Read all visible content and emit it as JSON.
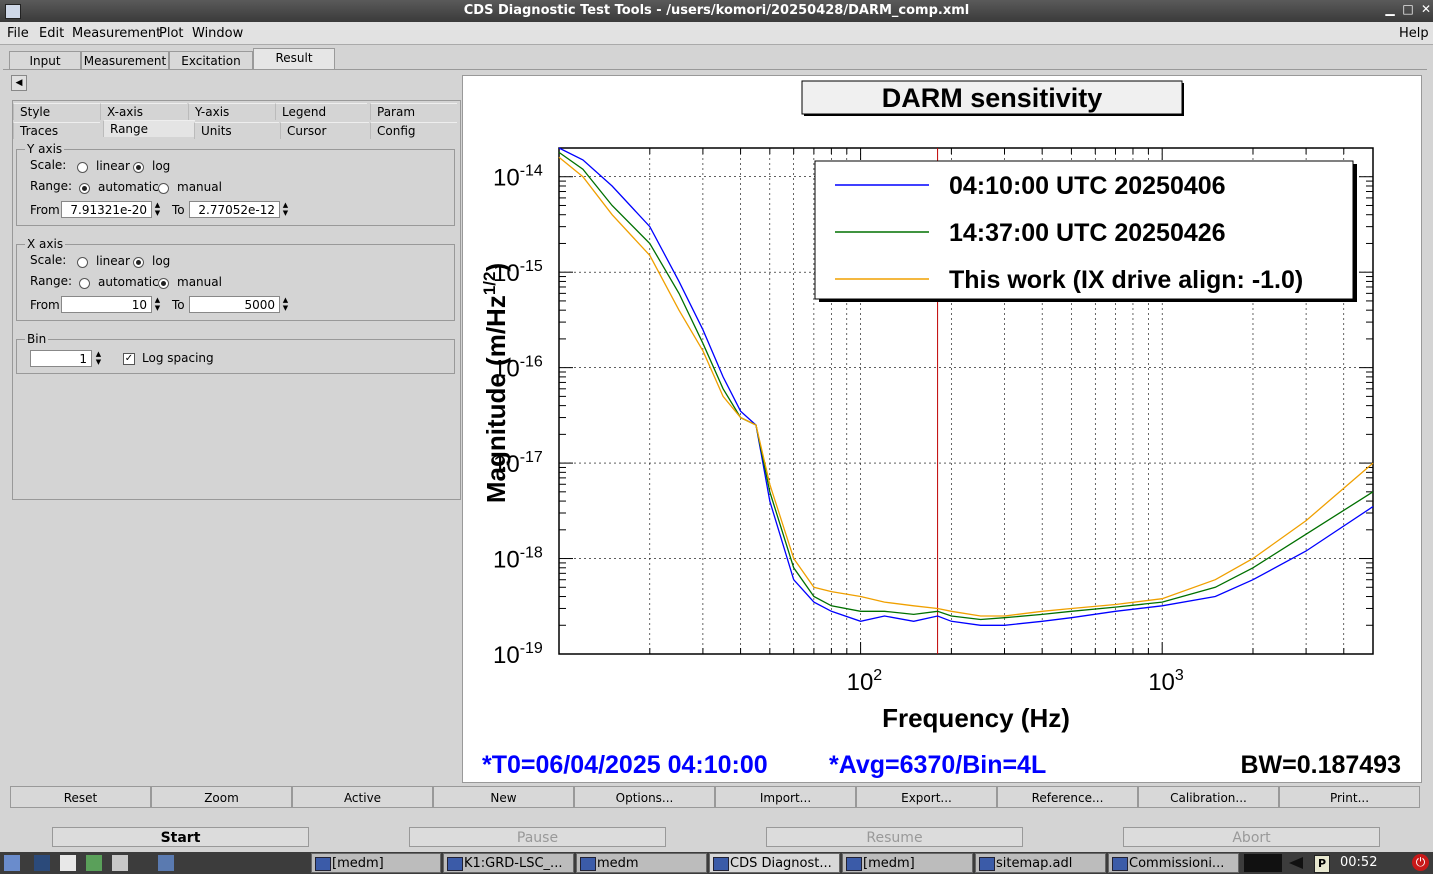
{
  "window": {
    "title": "CDS Diagnostic Test Tools - /users/komori/20250428/DARM_comp.xml"
  },
  "menu": {
    "items": [
      "File",
      "Edit",
      "Measurement",
      "Plot",
      "Window"
    ],
    "help": "Help"
  },
  "main_tabs": [
    "Input",
    "Measurement",
    "Excitation",
    "Result"
  ],
  "sub_tabs_row1": [
    "Style",
    "X-axis",
    "Y-axis",
    "Legend",
    "Param"
  ],
  "sub_tabs_row2": [
    "Traces",
    "Range",
    "Units",
    "Cursor",
    "Config"
  ],
  "yaxis": {
    "legend": "Y axis",
    "scale_label": "Scale:",
    "linear": "linear",
    "log": "log",
    "range_label": "Range:",
    "automatic": "automatic",
    "manual": "manual",
    "from_label": "From",
    "from": "7.91321e-20",
    "to_label": "To",
    "to": "2.77052e-12"
  },
  "xaxis": {
    "legend": "X axis",
    "scale_label": "Scale:",
    "linear": "linear",
    "log": "log",
    "range_label": "Range:",
    "automatic": "automatic",
    "manual": "manual",
    "from_label": "From",
    "from": "10",
    "to_label": "To",
    "to": "5000"
  },
  "bin": {
    "legend": "Bin",
    "value": "1",
    "log_spacing": "Log spacing"
  },
  "plot_buttons": [
    "Reset",
    "Zoom",
    "Active",
    "New",
    "Options...",
    "Import...",
    "Export...",
    "Reference...",
    "Calibration...",
    "Print..."
  ],
  "control_buttons": [
    "Start",
    "Pause",
    "Resume",
    "Abort"
  ],
  "chart_data": {
    "type": "line",
    "title": "DARM sensitivity",
    "xlabel": "Frequency (Hz)",
    "ylabel": "Magnitude (m/Hz",
    "ylabel_sup": "1/2",
    "ylabel_end": ")",
    "xscale": "log",
    "yscale": "log",
    "xlim": [
      10,
      5000
    ],
    "ylim": [
      1e-19,
      2e-14
    ],
    "xtick_labels": [
      {
        "base": "10",
        "exp": "2",
        "value": 100
      },
      {
        "base": "10",
        "exp": "3",
        "value": 1000
      }
    ],
    "ytick_labels": [
      {
        "base": "10",
        "exp": "-14",
        "value": 1e-14
      },
      {
        "base": "10",
        "exp": "-15",
        "value": 1e-15
      },
      {
        "base": "10",
        "exp": "-16",
        "value": 1e-16
      },
      {
        "base": "10",
        "exp": "-17",
        "value": 1e-17
      },
      {
        "base": "10",
        "exp": "-18",
        "value": 1e-18
      },
      {
        "base": "10",
        "exp": "-19",
        "value": 1e-19
      }
    ],
    "grid": true,
    "legend_position": "top-right",
    "cursor_x": 180,
    "series": [
      {
        "name": "04:10:00 UTC 20250406",
        "color": "#0000ff",
        "x": [
          10,
          12,
          15,
          20,
          25,
          30,
          35,
          40,
          45,
          50,
          60,
          70,
          80,
          100,
          120,
          150,
          180,
          200,
          250,
          300,
          400,
          500,
          700,
          1000,
          1500,
          2000,
          3000,
          5000
        ],
        "y": [
          2e-14,
          1.5e-14,
          8e-15,
          3e-15,
          8e-16,
          2.5e-16,
          8e-17,
          3.5e-17,
          2.5e-17,
          4e-18,
          6e-19,
          3.5e-19,
          2.8e-19,
          2.2e-19,
          2.5e-19,
          2.2e-19,
          2.5e-19,
          2.2e-19,
          2e-19,
          2e-19,
          2.2e-19,
          2.4e-19,
          2.8e-19,
          3.2e-19,
          4e-19,
          6e-19,
          1.2e-18,
          3.5e-18
        ]
      },
      {
        "name": "14:37:00 UTC 20250426",
        "color": "#007000",
        "x": [
          10,
          12,
          15,
          20,
          25,
          30,
          35,
          40,
          45,
          50,
          60,
          70,
          80,
          100,
          120,
          150,
          180,
          200,
          250,
          300,
          400,
          500,
          700,
          1000,
          1500,
          2000,
          3000,
          5000
        ],
        "y": [
          1.8e-14,
          1.2e-14,
          5e-15,
          2e-15,
          6e-16,
          1.8e-16,
          6e-17,
          3e-17,
          2.5e-17,
          5e-18,
          8e-19,
          4e-19,
          3.2e-19,
          2.8e-19,
          2.8e-19,
          2.6e-19,
          2.8e-19,
          2.5e-19,
          2.3e-19,
          2.4e-19,
          2.6e-19,
          2.8e-19,
          3.1e-19,
          3.5e-19,
          5e-19,
          8e-19,
          1.8e-18,
          5e-18
        ]
      },
      {
        "name": "This work (IX drive align: -1.0)",
        "color": "#f0a000",
        "x": [
          10,
          12,
          15,
          20,
          25,
          30,
          35,
          40,
          45,
          50,
          60,
          70,
          80,
          100,
          120,
          150,
          180,
          200,
          250,
          300,
          400,
          500,
          700,
          1000,
          1500,
          2000,
          3000,
          5000
        ],
        "y": [
          1.6e-14,
          1e-14,
          4e-15,
          1.5e-15,
          4e-16,
          1.5e-16,
          5e-17,
          3e-17,
          2.5e-17,
          6e-18,
          1e-18,
          5e-19,
          4.5e-19,
          4e-19,
          3.5e-19,
          3.2e-19,
          3e-19,
          2.8e-19,
          2.5e-19,
          2.5e-19,
          2.8e-19,
          3e-19,
          3.3e-19,
          3.8e-19,
          6e-19,
          1e-18,
          2.5e-18,
          1e-17
        ]
      }
    ],
    "annotations": {
      "t0": "*T0=06/04/2025 04:10:00",
      "avg": "*Avg=6370/Bin=4L",
      "bw": "BW=0.187493"
    }
  },
  "taskbar": {
    "items": [
      "[medm]",
      "K1:GRD-LSC_...",
      "medm",
      "CDS Diagnost...",
      "[medm]",
      "sitemap.adl",
      "Commissioni..."
    ],
    "clock": "00:52"
  }
}
